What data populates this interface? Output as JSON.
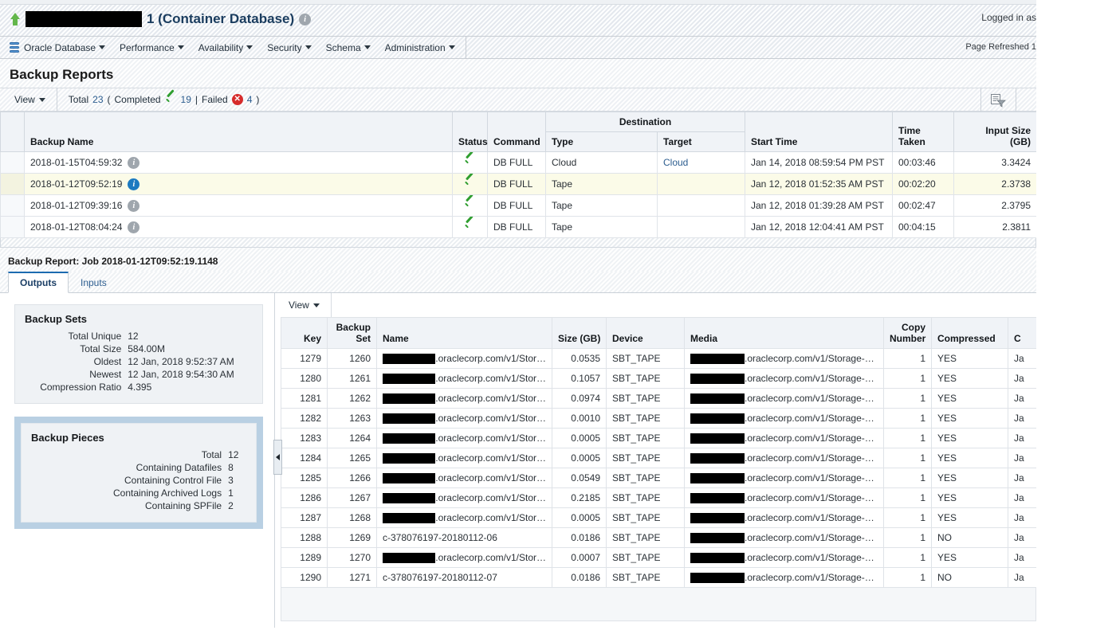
{
  "header": {
    "db_title_suffix": "1 (Container Database)",
    "redacted_width": 146,
    "info_icon": "info-icon",
    "logged_in_as": "Logged in as",
    "page_refreshed": "Page Refreshed 1"
  },
  "menubar": {
    "items": [
      {
        "label": "Oracle Database",
        "icon": "database-icon",
        "caret": true
      },
      {
        "label": "Performance",
        "caret": true
      },
      {
        "label": "Availability",
        "caret": true
      },
      {
        "label": "Security",
        "caret": true
      },
      {
        "label": "Schema",
        "caret": true
      },
      {
        "label": "Administration",
        "caret": true
      }
    ]
  },
  "page": {
    "title": "Backup Reports"
  },
  "summary": {
    "view_label": "View",
    "total_label": "Total",
    "total_value": "23",
    "open_paren": "(",
    "completed_label": "Completed",
    "completed_value": "19",
    "pipe": "|",
    "failed_label": "Failed",
    "failed_value": "4",
    "close_paren": ")",
    "detach_icon": "filter-detach-icon"
  },
  "reports_table": {
    "columns": {
      "backup_name": "Backup Name",
      "status": "Status",
      "command": "Command",
      "destination": "Destination",
      "dest_type": "Type",
      "dest_target": "Target",
      "start_time": "Start Time",
      "time_taken_l1": "Time",
      "time_taken_l2": "Taken",
      "input_size_l1": "Input Size",
      "input_size_l2": "(GB)"
    },
    "rows": [
      {
        "backup_name": "2018-01-15T04:59:32",
        "info": "info-icon-grey",
        "status": "completed",
        "command": "DB FULL",
        "dest_type": "Cloud",
        "dest_target": "Cloud",
        "dest_target_link": true,
        "start_time": "Jan 14, 2018 08:59:54 PM PST",
        "time_taken": "00:03:46",
        "input_size": "3.3424",
        "selected": false
      },
      {
        "backup_name": "2018-01-12T09:52:19",
        "info": "info-icon-blue",
        "status": "completed",
        "command": "DB FULL",
        "dest_type": "Tape",
        "dest_target": "",
        "dest_target_link": false,
        "start_time": "Jan 12, 2018 01:52:35 AM PST",
        "time_taken": "00:02:20",
        "input_size": "2.3738",
        "selected": true
      },
      {
        "backup_name": "2018-01-12T09:39:16",
        "info": "info-icon-grey",
        "status": "completed",
        "command": "DB FULL",
        "dest_type": "Tape",
        "dest_target": "",
        "dest_target_link": false,
        "start_time": "Jan 12, 2018 01:39:28 AM PST",
        "time_taken": "00:02:47",
        "input_size": "2.3795",
        "selected": false
      },
      {
        "backup_name": "2018-01-12T08:04:24",
        "info": "info-icon-grey",
        "status": "completed",
        "command": "DB FULL",
        "dest_type": "Tape",
        "dest_target": "",
        "dest_target_link": false,
        "start_time": "Jan 12, 2018 12:04:41 AM PST",
        "time_taken": "00:04:15",
        "input_size": "2.3811",
        "selected": false
      }
    ]
  },
  "detail": {
    "title": "Backup Report: Job 2018-01-12T09:52:19.1148",
    "tabs": [
      {
        "label": "Outputs",
        "active": true
      },
      {
        "label": "Inputs",
        "active": false
      }
    ],
    "backup_sets": {
      "heading": "Backup Sets",
      "fields": [
        {
          "key": "Total Unique",
          "value": "12"
        },
        {
          "key": "Total Size",
          "value": "584.00M"
        },
        {
          "key": "Oldest",
          "value": "12 Jan, 2018 9:52:37 AM"
        },
        {
          "key": "Newest",
          "value": "12 Jan, 2018 9:54:30 AM"
        },
        {
          "key": "Compression Ratio",
          "value": "4.395"
        }
      ]
    },
    "backup_pieces": {
      "heading": "Backup Pieces",
      "fields": [
        {
          "key": "Total",
          "value": "12"
        },
        {
          "key": "Containing Datafiles",
          "value": "8"
        },
        {
          "key": "Containing Control File",
          "value": "3"
        },
        {
          "key": "Containing Archived Logs",
          "value": "1"
        },
        {
          "key": "Containing SPFile",
          "value": "2"
        }
      ]
    },
    "collapse_handle": "collapse-panel-handle"
  },
  "pieces_table": {
    "view_label": "View",
    "columns": {
      "key": "Key",
      "backup_set_l1": "Backup",
      "backup_set_l2": "Set",
      "name": "Name",
      "size": "Size (GB)",
      "device": "Device",
      "media": "Media",
      "copy_number_l1": "Copy",
      "copy_number_l2": "Number",
      "compressed": "Compressed",
      "truncated": "C"
    },
    "name_suffix": ".oraclecorp.com/v1/Stor…",
    "media_suffix": ".oraclecorp.com/v1/Storage-…",
    "truncated_cell": "Ja",
    "rows": [
      {
        "key": "1279",
        "backup_set": "1260",
        "name": "",
        "name_redacted": true,
        "size": "0.0535",
        "device": "SBT_TAPE",
        "media_redacted": true,
        "copy_number": "1",
        "compressed": "YES"
      },
      {
        "key": "1280",
        "backup_set": "1261",
        "name": "",
        "name_redacted": true,
        "size": "0.1057",
        "device": "SBT_TAPE",
        "media_redacted": true,
        "copy_number": "1",
        "compressed": "YES"
      },
      {
        "key": "1281",
        "backup_set": "1262",
        "name": "",
        "name_redacted": true,
        "size": "0.0974",
        "device": "SBT_TAPE",
        "media_redacted": true,
        "copy_number": "1",
        "compressed": "YES"
      },
      {
        "key": "1282",
        "backup_set": "1263",
        "name": "",
        "name_redacted": true,
        "size": "0.0010",
        "device": "SBT_TAPE",
        "media_redacted": true,
        "copy_number": "1",
        "compressed": "YES"
      },
      {
        "key": "1283",
        "backup_set": "1264",
        "name": "",
        "name_redacted": true,
        "size": "0.0005",
        "device": "SBT_TAPE",
        "media_redacted": true,
        "copy_number": "1",
        "compressed": "YES"
      },
      {
        "key": "1284",
        "backup_set": "1265",
        "name": "",
        "name_redacted": true,
        "size": "0.0005",
        "device": "SBT_TAPE",
        "media_redacted": true,
        "copy_number": "1",
        "compressed": "YES"
      },
      {
        "key": "1285",
        "backup_set": "1266",
        "name": "",
        "name_redacted": true,
        "size": "0.0549",
        "device": "SBT_TAPE",
        "media_redacted": true,
        "copy_number": "1",
        "compressed": "YES"
      },
      {
        "key": "1286",
        "backup_set": "1267",
        "name": "",
        "name_redacted": true,
        "size": "0.2185",
        "device": "SBT_TAPE",
        "media_redacted": true,
        "copy_number": "1",
        "compressed": "YES"
      },
      {
        "key": "1287",
        "backup_set": "1268",
        "name": "",
        "name_redacted": true,
        "size": "0.0005",
        "device": "SBT_TAPE",
        "media_redacted": true,
        "copy_number": "1",
        "compressed": "YES"
      },
      {
        "key": "1288",
        "backup_set": "1269",
        "name": "c-378076197-20180112-06",
        "name_redacted": false,
        "size": "0.0186",
        "device": "SBT_TAPE",
        "media_redacted": true,
        "copy_number": "1",
        "compressed": "NO"
      },
      {
        "key": "1289",
        "backup_set": "1270",
        "name": "",
        "name_redacted": true,
        "size": "0.0007",
        "device": "SBT_TAPE",
        "media_redacted": true,
        "copy_number": "1",
        "compressed": "YES"
      },
      {
        "key": "1290",
        "backup_set": "1271",
        "name": "c-378076197-20180112-07",
        "name_redacted": false,
        "size": "0.0186",
        "device": "SBT_TAPE",
        "media_redacted": true,
        "copy_number": "1",
        "compressed": "NO"
      }
    ]
  },
  "colors": {
    "accent": "#1c6bb0",
    "link": "#2c5d8f",
    "success": "#2f9e2f",
    "error": "#d62b2b",
    "selected_row": "#fbfbe8",
    "panel_selected": "#b9d0e3"
  }
}
